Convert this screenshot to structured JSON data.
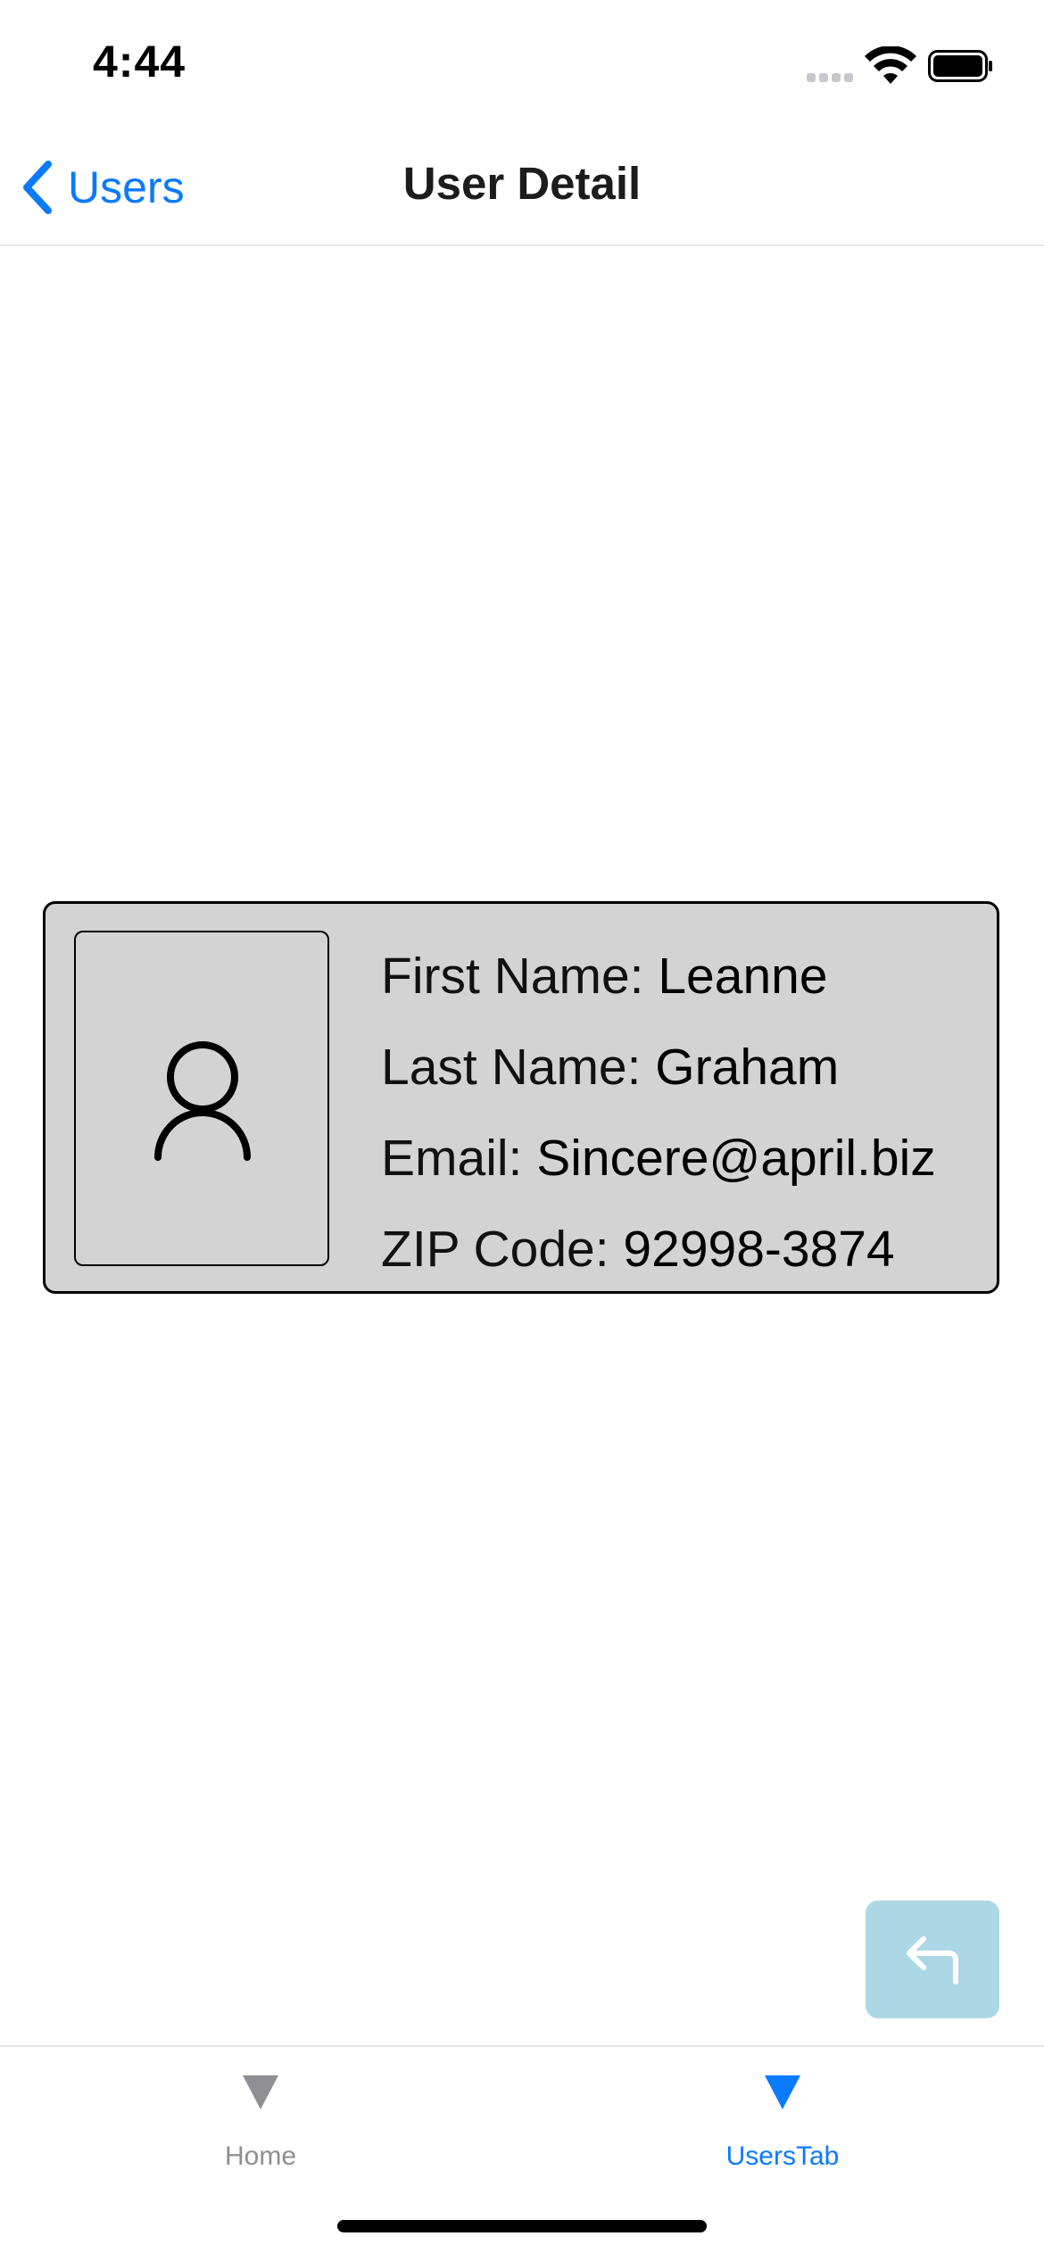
{
  "status_bar": {
    "time": "4:44"
  },
  "nav": {
    "back_label": "Users",
    "title": "User Detail"
  },
  "user": {
    "fields": [
      {
        "label": "First Name: ",
        "value": "Leanne"
      },
      {
        "label": "Last Name: ",
        "value": "Graham"
      },
      {
        "label": "Email: ",
        "value": "Sincere@april.biz"
      },
      {
        "label": "ZIP Code: ",
        "value": "92998-3874"
      }
    ],
    "avatar_icon": "person-outline-icon"
  },
  "fab": {
    "icon": "return-arrow-icon"
  },
  "tab_bar": {
    "tabs": [
      {
        "label": "Home",
        "icon": "triangle-down-icon",
        "active": false
      },
      {
        "label": "UsersTab",
        "icon": "triangle-down-icon",
        "active": true
      }
    ]
  },
  "colors": {
    "accent": "#0a7aff",
    "inactive_tab": "#8e8e93",
    "card_background": "#d3d3d3",
    "fab_background": "#acd8e6"
  }
}
